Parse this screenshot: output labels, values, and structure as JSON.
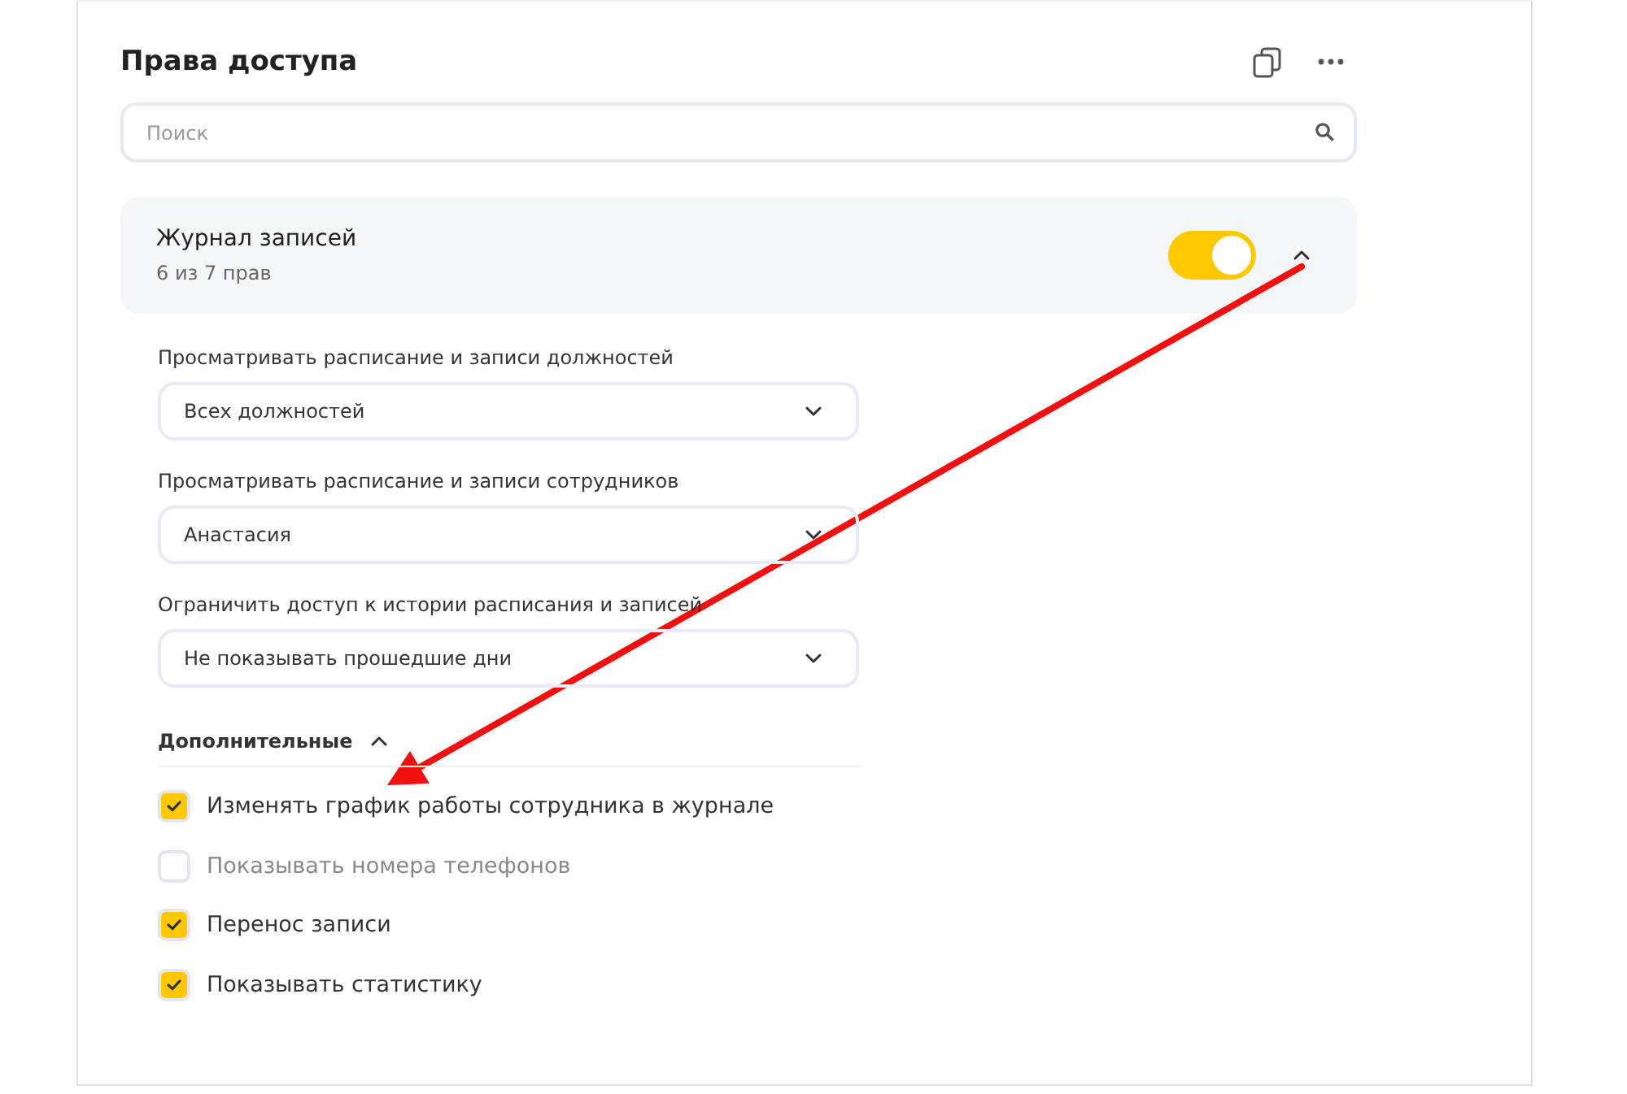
{
  "panel": {
    "title": "Права доступа",
    "search": {
      "placeholder": "Поиск"
    },
    "section": {
      "title": "Журнал записей",
      "count": "6 из 7 прав",
      "enabled": true,
      "expanded": true,
      "selects": [
        {
          "label": "Просматривать расписание и записи должностей",
          "value": "Всех должностей"
        },
        {
          "label": "Просматривать расписание и записи сотрудников",
          "value": "Анастасия"
        },
        {
          "label": "Ограничить доступ к истории расписания и записей",
          "value": "Не показывать прошедшие дни"
        }
      ],
      "extra": {
        "title": "Дополнительные",
        "expanded": true,
        "items": [
          {
            "label": "Изменять график работы сотрудника в журнале",
            "checked": true
          },
          {
            "label": "Показывать номера телефонов",
            "checked": false
          },
          {
            "label": "Перенос записи",
            "checked": true
          },
          {
            "label": "Показывать статистику",
            "checked": true
          }
        ]
      }
    }
  }
}
